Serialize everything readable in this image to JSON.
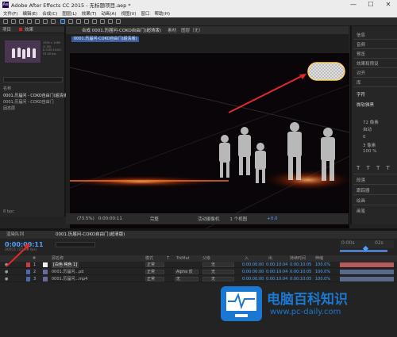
{
  "window": {
    "title": "Adobe After Effects CC 2015 - 无标题项目.aep *",
    "app_icon_text": "Ae",
    "controls": [
      "—",
      "☐",
      "✕"
    ]
  },
  "menubar": [
    "文件(F)",
    "编辑(E)",
    "合成(C)",
    "图层(L)",
    "效果(T)",
    "动画(A)",
    "视图(V)",
    "窗口",
    "帮助(H)"
  ],
  "project": {
    "tab_label": "项目",
    "tab2_label": "效果",
    "thumb_info": "1920 x 1080 (1.00)\nΔ 0:00:10:00, 25.00 fps",
    "search_label": "名称",
    "items": [
      "0001.历届问 - COKO自由门(超清版)",
      "0001.历届问 - COKO自由门",
      "固态层"
    ],
    "footer": "8 bpc"
  },
  "viewer": {
    "tabs": [
      "合成 0001.历届问-COKO自由门(超清版)",
      "素材",
      "图层（无）"
    ],
    "comp_label": "0001.历届问-COKO自由门(超清版)",
    "zoom": "(73.5%)",
    "timecode": "0:00:00:11",
    "quality": "完整",
    "camera": "活动摄像机",
    "view": "1 个视图",
    "exposure": "+0.0"
  },
  "rightpanel": {
    "items": [
      "信息",
      "音频",
      "预览",
      "效果和预设",
      "对齐",
      "库",
      "字符",
      "段落",
      "跟踪器",
      "绘画",
      "画笔"
    ],
    "font": "微软雅黑",
    "font_size": "72 像素",
    "leading": "自动",
    "tracking": "0",
    "stroke": "3 像素",
    "percent": "100 %"
  },
  "timeline": {
    "tabs": [
      "渲染队列",
      "0001.历届问-COKO自由门(超清版)"
    ],
    "timecode": "0:00:00:11",
    "timecode_sub": "00011 (25.00 fps)",
    "headers": [
      "#",
      "源名称",
      "模式",
      "T",
      "TrkMat",
      "父级",
      "入",
      "出",
      "持续时间",
      "伸缩"
    ],
    "rows": [
      {
        "num": "1",
        "name": "[白色 纯色 1]",
        "mode": "正常",
        "trk": "",
        "parent": "无",
        "in": "0:00:00:00",
        "out": "0:00:10:04",
        "dur": "0:00:10:05",
        "stretch": "100.0%",
        "color": "#c44040"
      },
      {
        "num": "2",
        "name": "0001.历届问...pd",
        "mode": "正常",
        "trk": "Alpha 反",
        "parent": "无",
        "in": "0:00:00:00",
        "out": "0:00:10:04",
        "dur": "0:00:10:05",
        "stretch": "100.0%",
        "color": "#4a6ab0"
      },
      {
        "num": "3",
        "name": "0001.历届问...mp4",
        "mode": "正常",
        "trk": "无",
        "parent": "无",
        "in": "0:00:00:00",
        "out": "0:00:10:04",
        "dur": "0:00:10:05",
        "stretch": "100.0%",
        "color": "#4a6ab0"
      }
    ],
    "ruler": [
      "0:00s",
      "02s"
    ]
  },
  "watermark": {
    "brand": "电脑百科知识",
    "url": "www.pc-daily.com"
  },
  "colors": {
    "accent_blue": "#4da3ff",
    "arrow_red": "#e02a2a",
    "watermark_blue": "#1a78d2"
  }
}
